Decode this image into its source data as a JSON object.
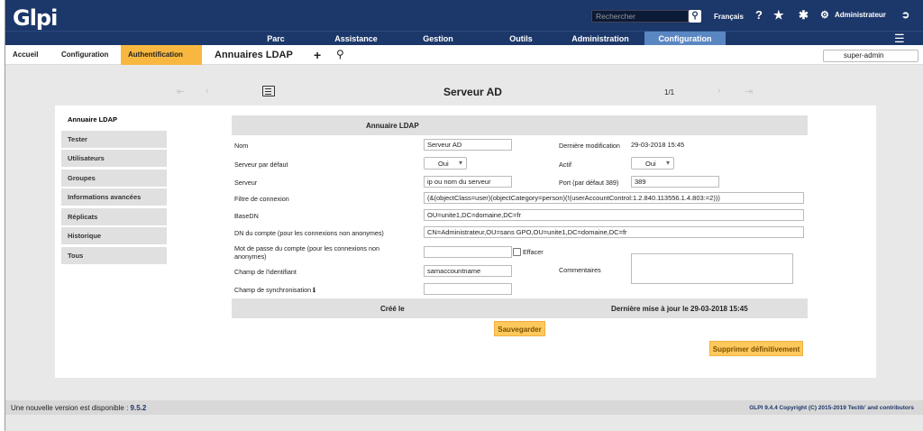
{
  "app": {
    "logo": "Glpi"
  },
  "header": {
    "search_placeholder": "Rechercher",
    "language": "Français",
    "user": "Administrateur"
  },
  "menu": {
    "items": [
      "Parc",
      "Assistance",
      "Gestion",
      "Outils",
      "Administration",
      "Configuration"
    ],
    "active": "Configuration"
  },
  "breadcrumb": {
    "items": [
      "Accueil",
      "Configuration",
      "Authentification"
    ],
    "title": "Annuaires LDAP"
  },
  "profile": {
    "selected": "super-admin"
  },
  "nav": {
    "title": "Serveur AD",
    "pager": "1/1"
  },
  "tabs": [
    "Annuaire LDAP",
    "Tester",
    "Utilisateurs",
    "Groupes",
    "Informations avancées",
    "Réplicats",
    "Historique",
    "Tous"
  ],
  "form": {
    "section_title": "Annuaire LDAP",
    "name_label": "Nom",
    "name_value": "Serveur AD",
    "last_modif_label": "Dernière modification",
    "last_modif_value": "29-03-2018 15:45",
    "default_server_label": "Serveur par défaut",
    "default_server_value": "Oui",
    "active_label": "Actif",
    "active_value": "Oui",
    "server_label": "Serveur",
    "server_value": "ip ou nom du serveur",
    "port_label": "Port (par défaut 389)",
    "port_value": "389",
    "filter_label": "Filtre de connexion",
    "filter_value": "(&(objectClass=user)(objectCategory=person)(!(userAccountControl:1.2.840.113556.1.4.803:=2)))",
    "basedn_label": "BaseDN",
    "basedn_value": "OU=unite1,DC=domaine,DC=fr",
    "dn_label": "DN du compte (pour les connexions non anonymes)",
    "dn_value": "CN=Administrateur,OU=sans GPO,OU=unite1,DC=domaine,DC=fr",
    "password_label": "Mot de passe du compte (pour les connexions non anonymes)",
    "password_value": "",
    "erase_label": "Effacer",
    "id_field_label": "Champ de l'identifiant",
    "id_field_value": "samaccountname",
    "comments_label": "Commentaires",
    "sync_field_label": "Champ de synchronisation",
    "sync_field_value": "",
    "created_label": "Créé le",
    "last_update": "Dernière mise à jour le 29-03-2018 15:45",
    "save_button": "Sauvegarder",
    "delete_button": "Supprimer définitivement"
  },
  "footer": {
    "update_text": "Une nouvelle version est disponible :",
    "update_version": "9.5.2",
    "copyright": "GLPI 9.4.4 Copyright (C) 2015-2019 Teclib' and contributors"
  },
  "icons": [
    "search-icon",
    "help-icon",
    "star-icon",
    "bug-icon",
    "gear-icon",
    "logout-icon",
    "hamburger-icon",
    "add-icon",
    "list-icon",
    "info-icon",
    "first-icon",
    "prev-icon",
    "next-icon",
    "last-icon"
  ],
  "colors": {
    "header": "#1c3769",
    "active_menu": "#5a87c2",
    "breadcrumb_active": "#f8b840",
    "button": "#fec95c"
  }
}
